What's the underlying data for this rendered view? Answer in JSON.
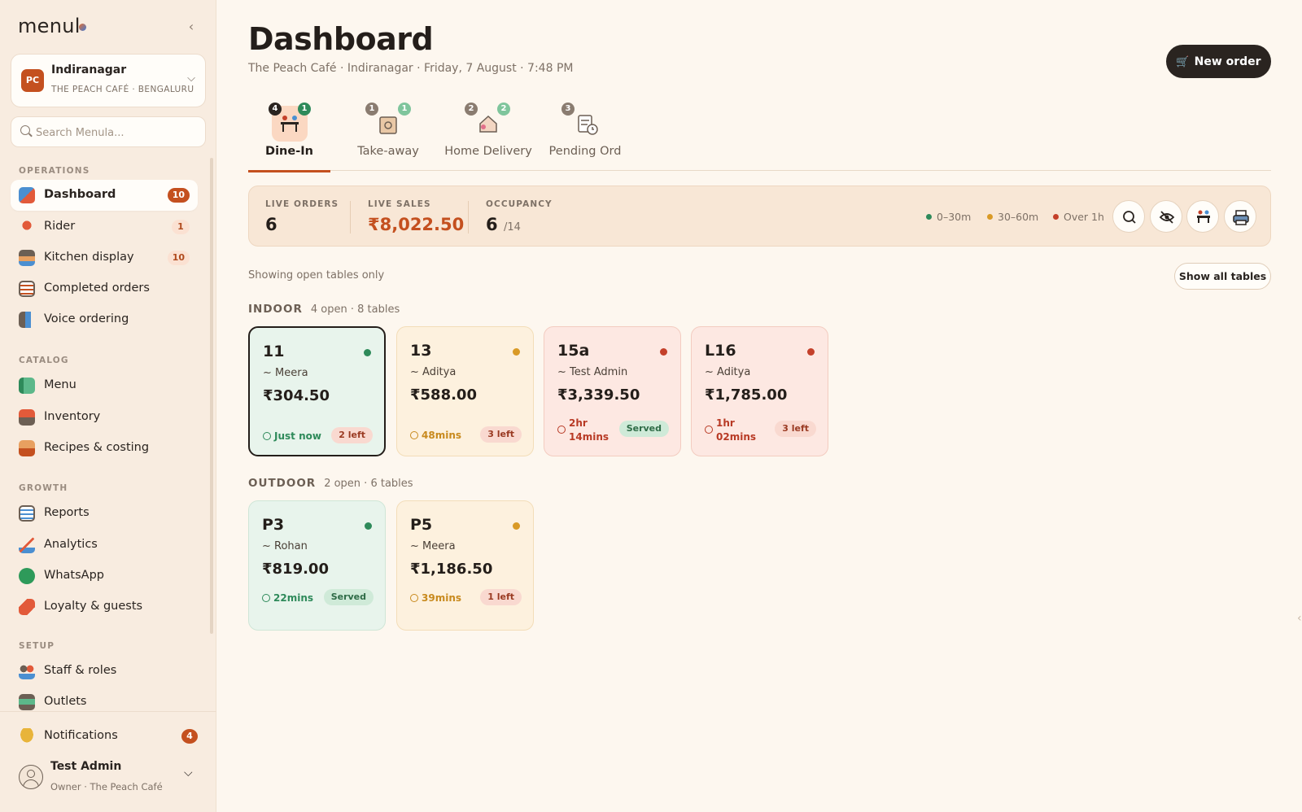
{
  "brand": {
    "logo_text": "menul",
    "logo_dot_colors": [
      "#e76f2f",
      "#3d7bd8"
    ]
  },
  "outlet": {
    "initials": "PC",
    "name": "Indiranagar",
    "subtitle": "THE PEACH CAFÉ · BENGALURU"
  },
  "search": {
    "placeholder": "Search Menula..."
  },
  "sidebar": {
    "sections": [
      "OPERATIONS",
      "CATALOG",
      "GROWTH",
      "SETUP"
    ],
    "operations": [
      {
        "label": "Dashboard",
        "badge": "10",
        "icon": "dashboard-icon"
      },
      {
        "label": "Rider",
        "badge": "1",
        "icon": "rider-icon"
      },
      {
        "label": "Kitchen display",
        "badge": "10",
        "icon": "kitchen-icon"
      },
      {
        "label": "Completed orders",
        "badge": "",
        "icon": "checklist-icon"
      },
      {
        "label": "Voice ordering",
        "badge": "",
        "icon": "megaphone-icon"
      }
    ],
    "catalog": [
      {
        "label": "Menu",
        "icon": "menu-book-icon"
      },
      {
        "label": "Inventory",
        "icon": "inventory-icon"
      },
      {
        "label": "Recipes & costing",
        "icon": "recipes-icon"
      }
    ],
    "growth": [
      {
        "label": "Reports",
        "icon": "reports-icon"
      },
      {
        "label": "Analytics",
        "icon": "analytics-icon"
      },
      {
        "label": "WhatsApp",
        "icon": "whatsapp-icon"
      },
      {
        "label": "Loyalty & guests",
        "icon": "loyalty-icon"
      }
    ],
    "setup": [
      {
        "label": "Staff & roles",
        "icon": "staff-icon"
      },
      {
        "label": "Outlets",
        "icon": "outlets-icon"
      }
    ],
    "notifications": {
      "label": "Notifications",
      "badge": "4"
    },
    "user": {
      "name": "Test Admin",
      "role": "Owner · The Peach Café"
    }
  },
  "header": {
    "title": "Dashboard",
    "subtitle": "The Peach Café · Indiranagar · Friday, 7 August · 7:48 PM",
    "new_order_label": "New order"
  },
  "tabs": [
    {
      "label": "Dine-In",
      "count_a": "4",
      "count_b": "1"
    },
    {
      "label": "Take-away",
      "count_a": "1",
      "count_b": "1"
    },
    {
      "label": "Home Delivery",
      "count_a": "2",
      "count_b": "2"
    },
    {
      "label": "Pending Ord",
      "count_a": "3",
      "count_b": ""
    }
  ],
  "stats": {
    "live_orders_label": "LIVE ORDERS",
    "live_orders": "6",
    "live_sales_label": "LIVE SALES",
    "live_sales": "₹8,022.50",
    "occupancy_label": "OCCUPANCY",
    "occupancy": "6",
    "occupancy_max": "/14",
    "legend": [
      {
        "label": "0–30m",
        "color": "#2e8a5a"
      },
      {
        "label": "30–60m",
        "color": "#d99a26"
      },
      {
        "label": "Over 1h",
        "color": "#c4402a"
      }
    ]
  },
  "filter": {
    "text": "Showing open tables only",
    "show_all_label": "Show all tables"
  },
  "zones": [
    {
      "title": "INDOOR",
      "meta": "4 open · 8 tables",
      "tables": [
        {
          "num": "11",
          "who": "~ Meera",
          "amount": "₹304.50",
          "time": "Just now",
          "pill": "2 left",
          "status": "green"
        },
        {
          "num": "13",
          "who": "~ Aditya",
          "amount": "₹588.00",
          "time": "48mins",
          "pill": "3 left",
          "status": "amber"
        },
        {
          "num": "15a",
          "who": "~ Test Admin",
          "amount": "₹3,339.50",
          "time_l1": "2hr",
          "time_l2": "14mins",
          "pill": "Served",
          "status": "red"
        },
        {
          "num": "L16",
          "who": "~ Aditya",
          "amount": "₹1,785.00",
          "time_l1": "1hr",
          "time_l2": "02mins",
          "pill": "3 left",
          "status": "red"
        }
      ]
    },
    {
      "title": "OUTDOOR",
      "meta": "2 open · 6 tables",
      "tables": [
        {
          "num": "P3",
          "who": "~ Rohan",
          "amount": "₹819.00",
          "time": "22mins",
          "pill": "Served",
          "status": "green"
        },
        {
          "num": "P5",
          "who": "~ Meera",
          "amount": "₹1,186.50",
          "time": "39mins",
          "pill": "1 left",
          "status": "amber"
        }
      ]
    }
  ],
  "colors": {
    "accent": "#c4501f",
    "dark": "#2a2420",
    "green": "#2e8a5a",
    "amber": "#d99a26",
    "red": "#c4402a"
  }
}
